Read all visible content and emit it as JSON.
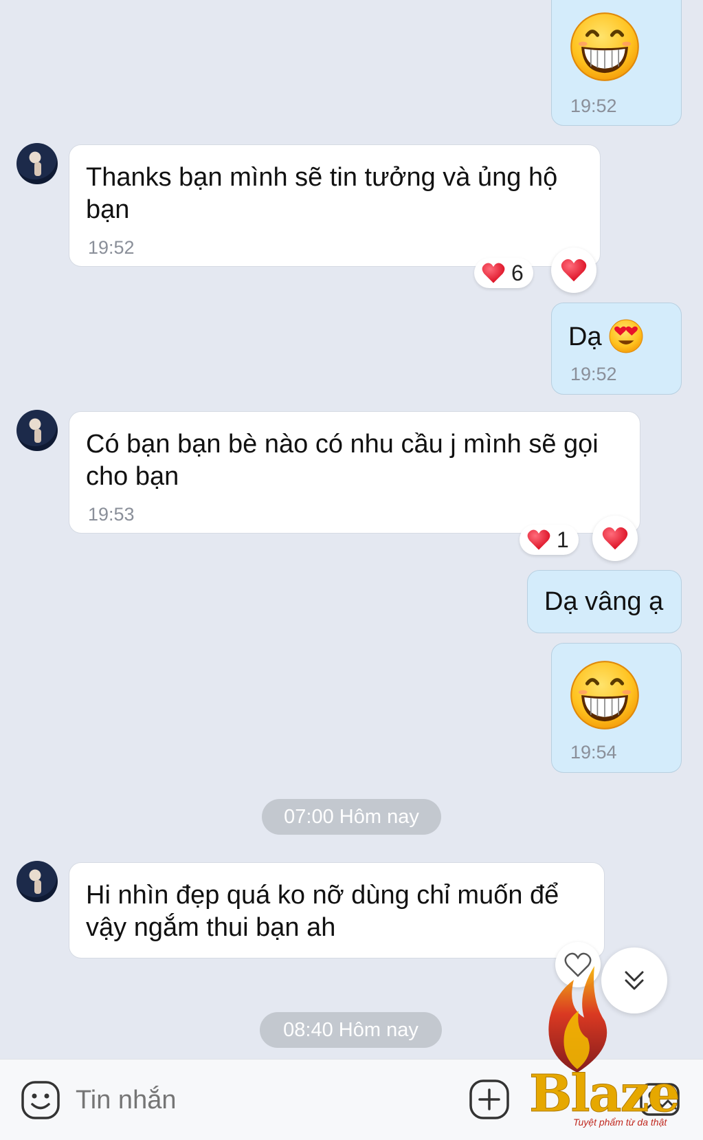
{
  "messages": {
    "m1": {
      "time": "19:52"
    },
    "m2": {
      "text": "Thanks bạn mình sẽ tin tưởng và ủng hộ bạn",
      "time": "19:52",
      "reaction_count": "6"
    },
    "m3": {
      "text": "Dạ",
      "time": "19:52"
    },
    "m4": {
      "text": "Có bạn bạn bè nào có nhu cầu j mình sẽ gọi cho bạn",
      "time": "19:53",
      "reaction_count": "1"
    },
    "m5": {
      "text": "Dạ vâng ạ"
    },
    "m6": {
      "time": "19:54"
    },
    "m7": {
      "text": "Hi nhìn đẹp quá ko nỡ dùng chỉ muốn để vậy ngắm thui bạn ah"
    }
  },
  "date_separators": [
    "07:00 Hôm nay",
    "08:40 Hôm nay"
  ],
  "composer": {
    "placeholder": "Tin nhắn"
  },
  "watermark": {
    "brand": "Blaze",
    "tagline": "Tuyệt phẩm từ da thật"
  },
  "colors": {
    "background": "#e4e8f1",
    "incoming_bubble": "#ffffff",
    "outgoing_bubble": "#d4ecfb",
    "heart": "#e8122a"
  },
  "icons": [
    "sticker-icon",
    "plus-icon",
    "image-icon",
    "heart-icon",
    "heart-outline-icon",
    "chevron-double-down-icon"
  ]
}
